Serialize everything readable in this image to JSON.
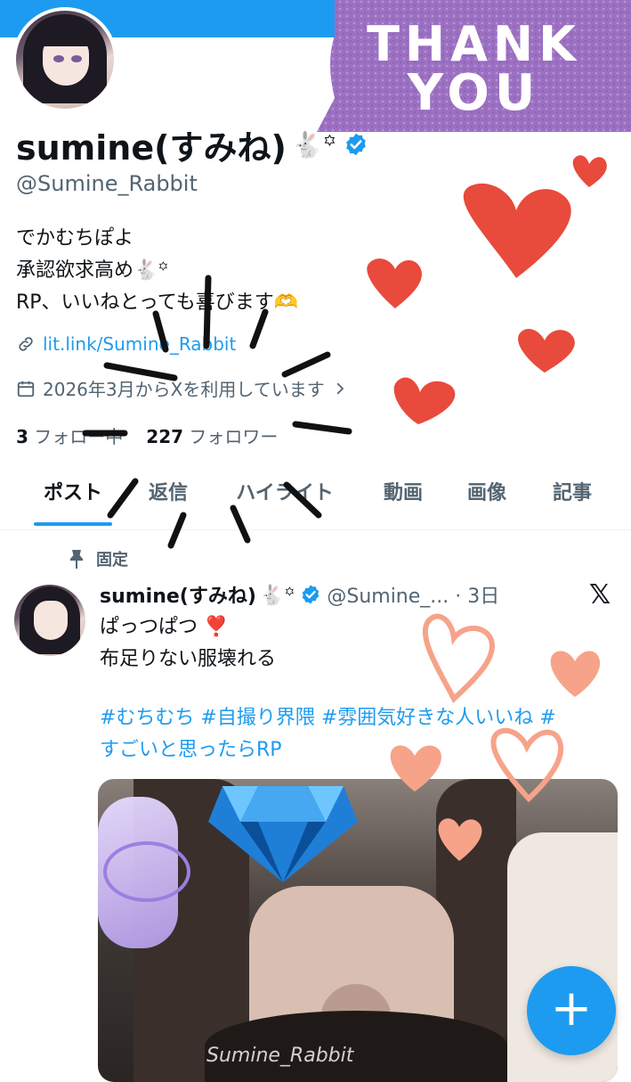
{
  "profile": {
    "name": "sumine(すみね)",
    "name_emoji": "🐇꙳",
    "handle": "@Sumine_Rabbit",
    "bio": [
      "でかむちぽよ",
      "承認欲求高め🐇꙳",
      "RP、いいねとっても喜びます🫶"
    ],
    "link": "lit.link/Sumine_Rabbit",
    "joined": "2026年3月からXを利用しています",
    "following_count": "3",
    "following_label": "フォロー中",
    "followers_count": "227",
    "followers_label": "フォロワー"
  },
  "sticker": {
    "line1": "THANK",
    "line2": "YOU"
  },
  "tabs": [
    "ポスト",
    "返信",
    "ハイライト",
    "動画",
    "画像",
    "記事"
  ],
  "active_tab": "ポスト",
  "post": {
    "pinned_label": "固定",
    "author": "sumine(すみね)",
    "author_emoji": "🐇꙳",
    "handle_time": "@Sumine_... · 3日",
    "lines": [
      "ぱっつぱつ ❣️",
      "布足りない服壊れる"
    ],
    "hashtags": [
      "#むちむち #自撮り界隈 #雰囲気好きな人いいね #",
      "すごいと思ったらRP"
    ],
    "media_watermark": "Sumine_Rabbit"
  },
  "fab": {
    "label": "+"
  },
  "colors": {
    "accent": "#1d9bf0",
    "sticker": "#9b6fc2",
    "hearts": "#e84a3c",
    "outline_hearts": "#f6a38a"
  },
  "icons": [
    "verified-badge-icon",
    "link-icon",
    "calendar-icon",
    "chevron-right-icon",
    "pin-icon",
    "x-logo-icon",
    "plus-icon"
  ]
}
